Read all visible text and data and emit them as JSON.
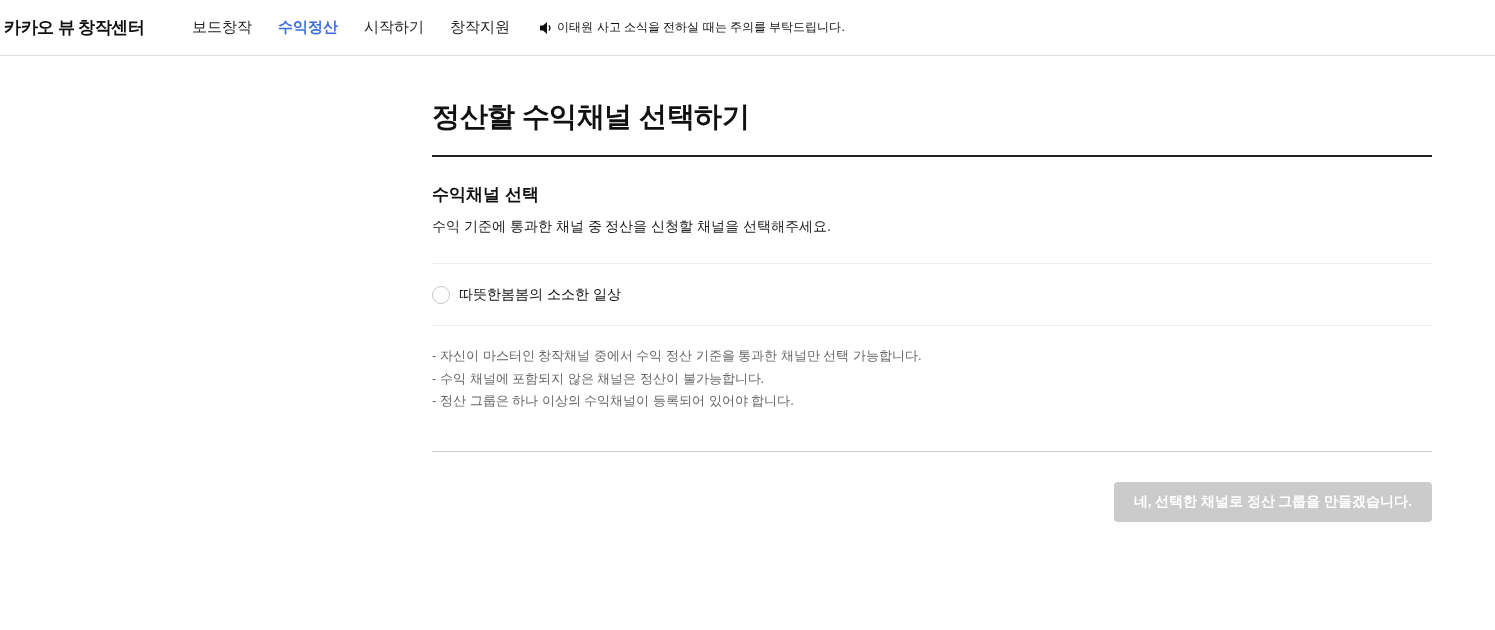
{
  "header": {
    "logo": "카카오 뷰 창작센터",
    "nav": [
      {
        "label": "보드창작",
        "selected": false
      },
      {
        "label": "수익정산",
        "selected": true
      },
      {
        "label": "시작하기",
        "selected": false
      },
      {
        "label": "창작지원",
        "selected": false
      }
    ],
    "notice": "이태원 사고 소식을 전하실 때는 주의를 부탁드립니다."
  },
  "page": {
    "title": "정산할 수익채널 선택하기",
    "section_title": "수익채널 선택",
    "description": "수익 기준에 통과한 채널 중 정산을 신청할 채널을 선택해주세요.",
    "channels": [
      {
        "name": "따뜻한봄봄의 소소한 일상",
        "selected": false
      }
    ],
    "notes": [
      "- 자신이 마스터인 창작채널 중에서 수익 정산 기준을 통과한 채널만 선택 가능합니다.",
      "- 수익 채널에 포함되지 않은 채널은 정산이 불가능합니다.",
      "- 정산 그룹은 하나 이상의 수익채널이 등록되어 있어야 합니다."
    ],
    "submit_button": {
      "label": "네, 선택한 채널로 정산 그룹을 만들겠습니다.",
      "disabled": true
    }
  }
}
